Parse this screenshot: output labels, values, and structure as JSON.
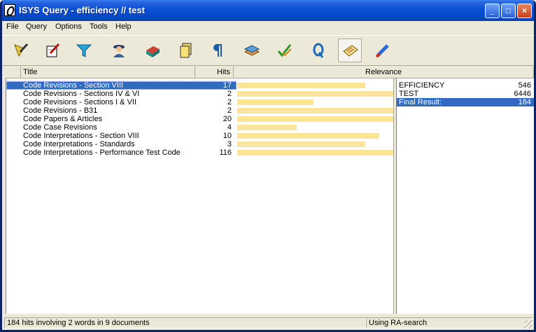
{
  "window": {
    "title": "ISYS Query - efficiency // test",
    "controls": {
      "minimize": "_",
      "maximize": "□",
      "close": "×"
    }
  },
  "menu": [
    "File",
    "Query",
    "Options",
    "Tools",
    "Help"
  ],
  "toolbar": {
    "icons": [
      "query-pen-icon",
      "notepad-pen-icon",
      "funnel-icon",
      "detective-icon",
      "card-box-icon",
      "documents-icon",
      "paragraph-icon",
      "stack-icon",
      "checkmarks-icon",
      "q-letter-icon",
      "checked-list-icon",
      "highlighter-icon"
    ],
    "active_index": 10
  },
  "columns": {
    "title": "Title",
    "hits": "Hits",
    "relevance": "Relevance"
  },
  "results": [
    {
      "title": "Code Revisions - Section VIII",
      "hits": "17",
      "relevance": 0.82
    },
    {
      "title": "Code Revisions - Sections IV & VI",
      "hits": "2",
      "relevance": 1.0
    },
    {
      "title": "Code Revisions - Sections I & VII",
      "hits": "2",
      "relevance": 0.49
    },
    {
      "title": "Code Revisions - B31",
      "hits": "2",
      "relevance": 1.0
    },
    {
      "title": "Code Papers & Articles",
      "hits": "20",
      "relevance": 1.0
    },
    {
      "title": "Code Case Revisions",
      "hits": "4",
      "relevance": 0.38
    },
    {
      "title": "Code Interpretations - Section VIII",
      "hits": "10",
      "relevance": 0.91
    },
    {
      "title": "Code Interpretations - Standards",
      "hits": "3",
      "relevance": 0.82
    },
    {
      "title": "Code Interpretations - Performance Test Code",
      "hits": "116",
      "relevance": 1.0
    }
  ],
  "selected_index": 0,
  "terms": [
    {
      "term": "EFFICIENCY",
      "count": "546"
    },
    {
      "term": "TEST",
      "count": "6446"
    },
    {
      "term": "Final Result:",
      "count": "184"
    }
  ],
  "status": {
    "left": "184 hits involving  2 words in  9 documents",
    "right": "Using RA-search"
  },
  "colors": {
    "bar": "#fbe497",
    "selection": "#316ac5",
    "titlebar": "#0a4fd6"
  }
}
